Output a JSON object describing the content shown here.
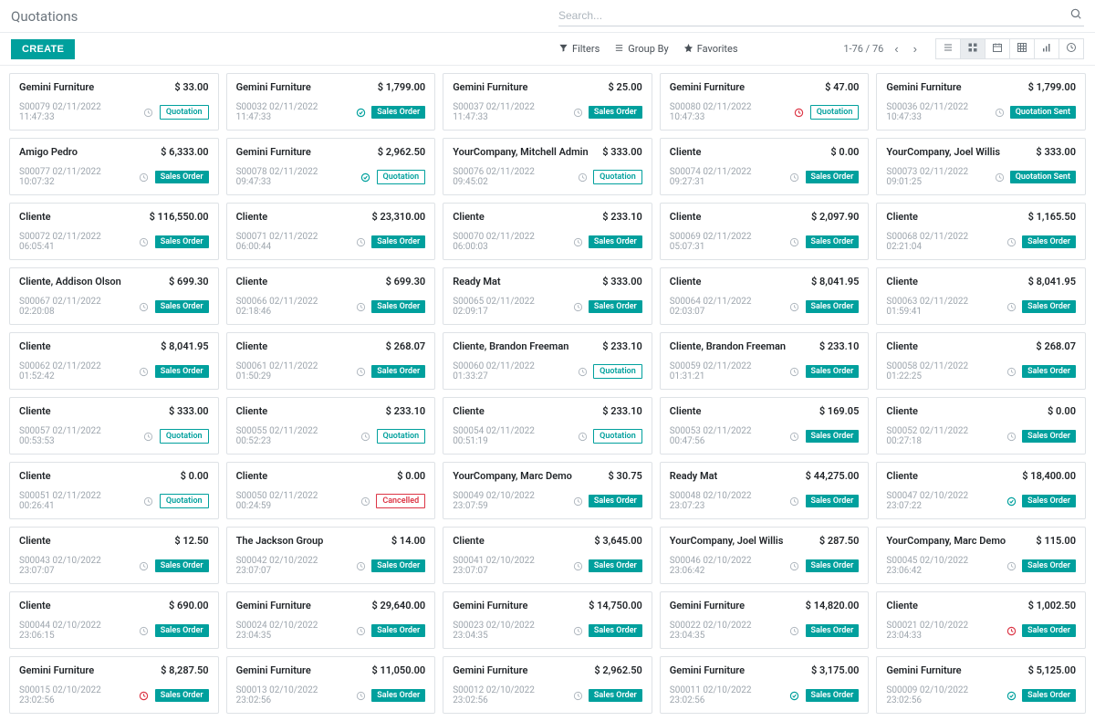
{
  "page_title": "Quotations",
  "search_placeholder": "Search...",
  "create_label": "CREATE",
  "filters": {
    "filters": "Filters",
    "groupby": "Group By",
    "favorites": "Favorites"
  },
  "pager": "1-76 / 76",
  "status_labels": {
    "Quotation": "Quotation",
    "Sales Order": "Sales Order",
    "Quotation Sent": "Quotation Sent",
    "Cancelled": "Cancelled"
  },
  "cards": [
    {
      "customer": "Gemini Furniture",
      "amount": "$ 33.00",
      "ref": "S00079 02/11/2022 11:47:33",
      "activity": "none",
      "status": "Quotation"
    },
    {
      "customer": "Gemini Furniture",
      "amount": "$ 1,799.00",
      "ref": "S00032 02/11/2022 11:47:33",
      "activity": "done",
      "status": "Sales Order"
    },
    {
      "customer": "Gemini Furniture",
      "amount": "$ 25.00",
      "ref": "S00037 02/11/2022 11:47:33",
      "activity": "none",
      "status": "Sales Order"
    },
    {
      "customer": "Gemini Furniture",
      "amount": "$ 47.00",
      "ref": "S00080 02/11/2022 10:47:33",
      "activity": "overdue",
      "status": "Quotation"
    },
    {
      "customer": "Gemini Furniture",
      "amount": "$ 1,799.00",
      "ref": "S00036 02/11/2022 10:47:33",
      "activity": "none",
      "status": "Quotation Sent"
    },
    {
      "customer": "Amigo Pedro",
      "amount": "$ 6,333.00",
      "ref": "S00077 02/11/2022 10:07:32",
      "activity": "none",
      "status": "Sales Order"
    },
    {
      "customer": "Gemini Furniture",
      "amount": "$ 2,962.50",
      "ref": "S00078 02/11/2022 09:47:33",
      "activity": "done",
      "status": "Quotation"
    },
    {
      "customer": "YourCompany, Mitchell Admin",
      "amount": "$ 333.00",
      "ref": "S00076 02/11/2022 09:45:02",
      "activity": "none",
      "status": "Quotation"
    },
    {
      "customer": "Cliente",
      "amount": "$ 0.00",
      "ref": "S00074 02/11/2022 09:27:31",
      "activity": "none",
      "status": "Sales Order"
    },
    {
      "customer": "YourCompany, Joel Willis",
      "amount": "$ 333.00",
      "ref": "S00073 02/11/2022 09:01:25",
      "activity": "none",
      "status": "Quotation Sent"
    },
    {
      "customer": "Cliente",
      "amount": "$ 116,550.00",
      "ref": "S00072 02/11/2022 06:05:41",
      "activity": "none",
      "status": "Sales Order"
    },
    {
      "customer": "Cliente",
      "amount": "$ 23,310.00",
      "ref": "S00071 02/11/2022 06:00:44",
      "activity": "none",
      "status": "Sales Order"
    },
    {
      "customer": "Cliente",
      "amount": "$ 233.10",
      "ref": "S00070 02/11/2022 06:00:03",
      "activity": "none",
      "status": "Sales Order"
    },
    {
      "customer": "Cliente",
      "amount": "$ 2,097.90",
      "ref": "S00069 02/11/2022 05:07:31",
      "activity": "none",
      "status": "Sales Order"
    },
    {
      "customer": "Cliente",
      "amount": "$ 1,165.50",
      "ref": "S00068 02/11/2022 02:21:04",
      "activity": "none",
      "status": "Sales Order"
    },
    {
      "customer": "Cliente, Addison Olson",
      "amount": "$ 699.30",
      "ref": "S00067 02/11/2022 02:20:08",
      "activity": "none",
      "status": "Sales Order"
    },
    {
      "customer": "Cliente",
      "amount": "$ 699.30",
      "ref": "S00066 02/11/2022 02:18:46",
      "activity": "none",
      "status": "Sales Order"
    },
    {
      "customer": "Ready Mat",
      "amount": "$ 333.00",
      "ref": "S00065 02/11/2022 02:09:17",
      "activity": "none",
      "status": "Sales Order"
    },
    {
      "customer": "Cliente",
      "amount": "$ 8,041.95",
      "ref": "S00064 02/11/2022 02:03:07",
      "activity": "none",
      "status": "Sales Order"
    },
    {
      "customer": "Cliente",
      "amount": "$ 8,041.95",
      "ref": "S00063 02/11/2022 01:59:41",
      "activity": "none",
      "status": "Sales Order"
    },
    {
      "customer": "Cliente",
      "amount": "$ 8,041.95",
      "ref": "S00062 02/11/2022 01:52:42",
      "activity": "none",
      "status": "Sales Order"
    },
    {
      "customer": "Cliente",
      "amount": "$ 268.07",
      "ref": "S00061 02/11/2022 01:50:29",
      "activity": "none",
      "status": "Sales Order"
    },
    {
      "customer": "Cliente, Brandon Freeman",
      "amount": "$ 233.10",
      "ref": "S00060 02/11/2022 01:33:27",
      "activity": "none",
      "status": "Quotation"
    },
    {
      "customer": "Cliente, Brandon Freeman",
      "amount": "$ 233.10",
      "ref": "S00059 02/11/2022 01:31:21",
      "activity": "none",
      "status": "Sales Order"
    },
    {
      "customer": "Cliente",
      "amount": "$ 268.07",
      "ref": "S00058 02/11/2022 01:22:25",
      "activity": "none",
      "status": "Sales Order"
    },
    {
      "customer": "Cliente",
      "amount": "$ 333.00",
      "ref": "S00057 02/11/2022 00:53:53",
      "activity": "none",
      "status": "Quotation"
    },
    {
      "customer": "Cliente",
      "amount": "$ 233.10",
      "ref": "S00055 02/11/2022 00:52:23",
      "activity": "none",
      "status": "Quotation"
    },
    {
      "customer": "Cliente",
      "amount": "$ 233.10",
      "ref": "S00054 02/11/2022 00:51:19",
      "activity": "none",
      "status": "Quotation"
    },
    {
      "customer": "Cliente",
      "amount": "$ 169.05",
      "ref": "S00053 02/11/2022 00:47:56",
      "activity": "none",
      "status": "Sales Order"
    },
    {
      "customer": "Cliente",
      "amount": "$ 0.00",
      "ref": "S00052 02/11/2022 00:27:18",
      "activity": "none",
      "status": "Sales Order"
    },
    {
      "customer": "Cliente",
      "amount": "$ 0.00",
      "ref": "S00051 02/11/2022 00:26:41",
      "activity": "none",
      "status": "Quotation"
    },
    {
      "customer": "Cliente",
      "amount": "$ 0.00",
      "ref": "S00050 02/11/2022 00:24:59",
      "activity": "none",
      "status": "Cancelled"
    },
    {
      "customer": "YourCompany, Marc Demo",
      "amount": "$ 30.75",
      "ref": "S00049 02/10/2022 23:07:59",
      "activity": "none",
      "status": "Sales Order"
    },
    {
      "customer": "Ready Mat",
      "amount": "$ 44,275.00",
      "ref": "S00048 02/10/2022 23:07:23",
      "activity": "none",
      "status": "Sales Order"
    },
    {
      "customer": "Cliente",
      "amount": "$ 18,400.00",
      "ref": "S00047 02/10/2022 23:07:22",
      "activity": "done",
      "status": "Sales Order"
    },
    {
      "customer": "Cliente",
      "amount": "$ 12.50",
      "ref": "S00043 02/10/2022 23:07:07",
      "activity": "none",
      "status": "Sales Order"
    },
    {
      "customer": "The Jackson Group",
      "amount": "$ 14.00",
      "ref": "S00042 02/10/2022 23:07:07",
      "activity": "none",
      "status": "Sales Order"
    },
    {
      "customer": "Cliente",
      "amount": "$ 3,645.00",
      "ref": "S00041 02/10/2022 23:07:07",
      "activity": "none",
      "status": "Sales Order"
    },
    {
      "customer": "YourCompany, Joel Willis",
      "amount": "$ 287.50",
      "ref": "S00046 02/10/2022 23:06:42",
      "activity": "none",
      "status": "Sales Order"
    },
    {
      "customer": "YourCompany, Marc Demo",
      "amount": "$ 115.00",
      "ref": "S00045 02/10/2022 23:06:42",
      "activity": "none",
      "status": "Sales Order"
    },
    {
      "customer": "Cliente",
      "amount": "$ 690.00",
      "ref": "S00044 02/10/2022 23:06:15",
      "activity": "none",
      "status": "Sales Order"
    },
    {
      "customer": "Gemini Furniture",
      "amount": "$ 29,640.00",
      "ref": "S00024 02/10/2022 23:04:35",
      "activity": "none",
      "status": "Sales Order"
    },
    {
      "customer": "Gemini Furniture",
      "amount": "$ 14,750.00",
      "ref": "S00023 02/10/2022 23:04:35",
      "activity": "none",
      "status": "Sales Order"
    },
    {
      "customer": "Gemini Furniture",
      "amount": "$ 14,820.00",
      "ref": "S00022 02/10/2022 23:04:35",
      "activity": "none",
      "status": "Sales Order"
    },
    {
      "customer": "Cliente",
      "amount": "$ 1,002.50",
      "ref": "S00021 02/10/2022 23:04:33",
      "activity": "overdue",
      "status": "Sales Order"
    },
    {
      "customer": "Gemini Furniture",
      "amount": "$ 8,287.50",
      "ref": "S00015 02/10/2022 23:02:56",
      "activity": "overdue",
      "status": "Sales Order"
    },
    {
      "customer": "Gemini Furniture",
      "amount": "$ 11,050.00",
      "ref": "S00013 02/10/2022 23:02:56",
      "activity": "none",
      "status": "Sales Order"
    },
    {
      "customer": "Gemini Furniture",
      "amount": "$ 2,962.50",
      "ref": "S00012 02/10/2022 23:02:56",
      "activity": "none",
      "status": "Sales Order"
    },
    {
      "customer": "Gemini Furniture",
      "amount": "$ 3,175.00",
      "ref": "S00011 02/10/2022 23:02:56",
      "activity": "done",
      "status": "Sales Order"
    },
    {
      "customer": "Gemini Furniture",
      "amount": "$ 5,125.00",
      "ref": "S00009 02/10/2022 23:02:56",
      "activity": "done",
      "status": "Sales Order"
    }
  ]
}
